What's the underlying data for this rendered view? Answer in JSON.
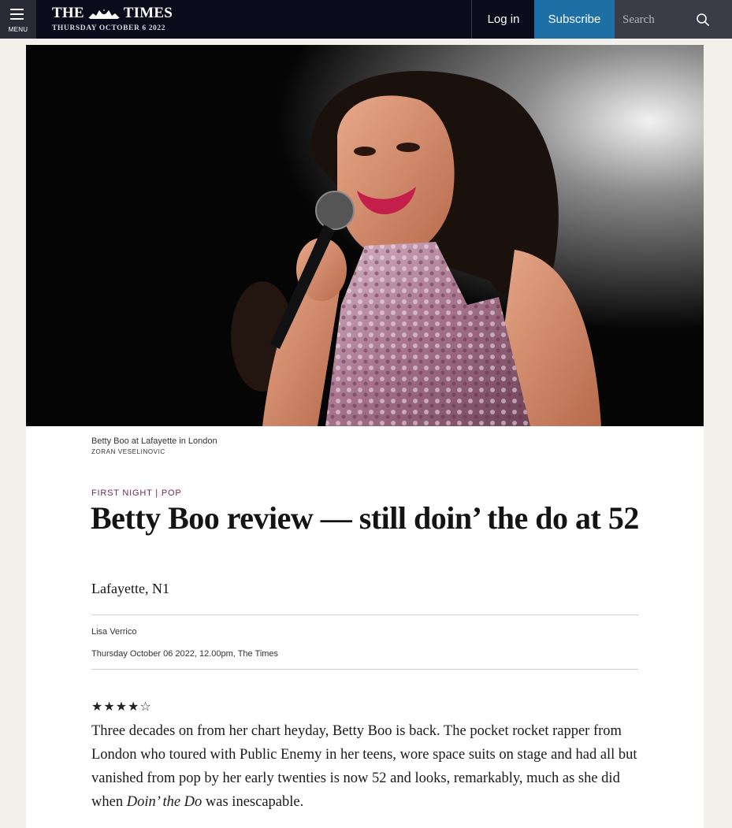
{
  "header": {
    "menu_label": "MENU",
    "masthead_left": "THE",
    "masthead_right": "TIMES",
    "date": "THURSDAY OCTOBER 6 2022",
    "login_label": "Log in",
    "subscribe_label": "Subscribe",
    "search_placeholder": "Search",
    "colors": {
      "bar": "#0b0b1c",
      "subscribe": "#1d6fa5",
      "search_bg": "#3c3c48"
    }
  },
  "article": {
    "image_caption": "Betty Boo at Lafayette in London",
    "image_credit": "ZORAN VESELINOVIC",
    "section": "FIRST NIGHT | POP",
    "headline": "Betty Boo review — still doin’ the do at 52",
    "standfirst": "Lafayette, N1",
    "author": "Lisa Verrico",
    "dateline": "Thursday October 06 2022, 12.00pm, The Times",
    "rating": {
      "value": 4,
      "max": 5,
      "display": "★★★★☆"
    },
    "body": {
      "before_title": "Three decades on from her chart heyday, Betty Boo is back. The pocket rocket rapper from London who toured with Public Enemy in her teens, wore space suits on stage and had all but vanished from pop by her early twenties is now 52 and looks, remarkably, much as she did when ",
      "title": "Doin’ the Do",
      "after_title": " was inescapable."
    }
  }
}
